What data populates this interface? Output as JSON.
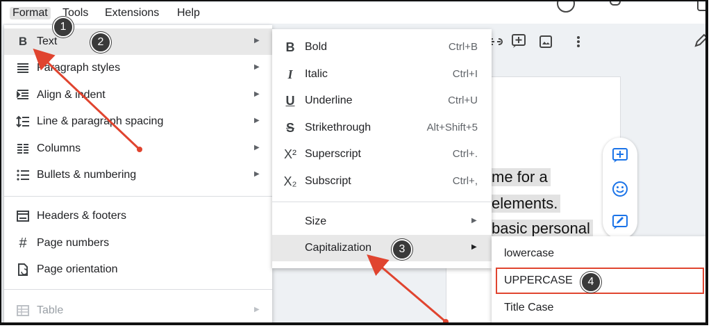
{
  "menubar": {
    "items": [
      "Format",
      "Tools",
      "Extensions",
      "Help"
    ]
  },
  "doc": {
    "lines": [
      "me for a",
      "elements.",
      "basic personal"
    ]
  },
  "format_menu": {
    "items": [
      {
        "label": "Text",
        "icon": "bold-icon"
      },
      {
        "label": "Paragraph styles",
        "icon": "paragraph-styles-icon"
      },
      {
        "label": "Align & indent",
        "icon": "align-indent-icon"
      },
      {
        "label": "Line & paragraph spacing",
        "icon": "line-spacing-icon"
      },
      {
        "label": "Columns",
        "icon": "columns-icon"
      },
      {
        "label": "Bullets & numbering",
        "icon": "bullets-icon"
      },
      {
        "label": "Headers & footers",
        "icon": "headers-footers-icon"
      },
      {
        "label": "Page numbers",
        "icon": "hash-icon"
      },
      {
        "label": "Page orientation",
        "icon": "page-orientation-icon"
      },
      {
        "label": "Table",
        "icon": "table-icon"
      }
    ]
  },
  "text_menu": {
    "items": [
      {
        "label": "Bold",
        "shortcut": "Ctrl+B",
        "icon": "bold-icon"
      },
      {
        "label": "Italic",
        "shortcut": "Ctrl+I",
        "icon": "italic-icon"
      },
      {
        "label": "Underline",
        "shortcut": "Ctrl+U",
        "icon": "underline-icon"
      },
      {
        "label": "Strikethrough",
        "shortcut": "Alt+Shift+5",
        "icon": "strikethrough-icon"
      },
      {
        "label": "Superscript",
        "shortcut": "Ctrl+.",
        "icon": "superscript-icon"
      },
      {
        "label": "Subscript",
        "shortcut": "Ctrl+,",
        "icon": "subscript-icon"
      },
      {
        "label": "Size"
      },
      {
        "label": "Capitalization"
      }
    ]
  },
  "capitalization_menu": {
    "items": [
      "lowercase",
      "UPPERCASE",
      "Title Case"
    ]
  },
  "callouts": [
    "1",
    "2",
    "3",
    "4"
  ],
  "colors": {
    "annotation": "#e0442f",
    "accent": "#1a73e8"
  }
}
